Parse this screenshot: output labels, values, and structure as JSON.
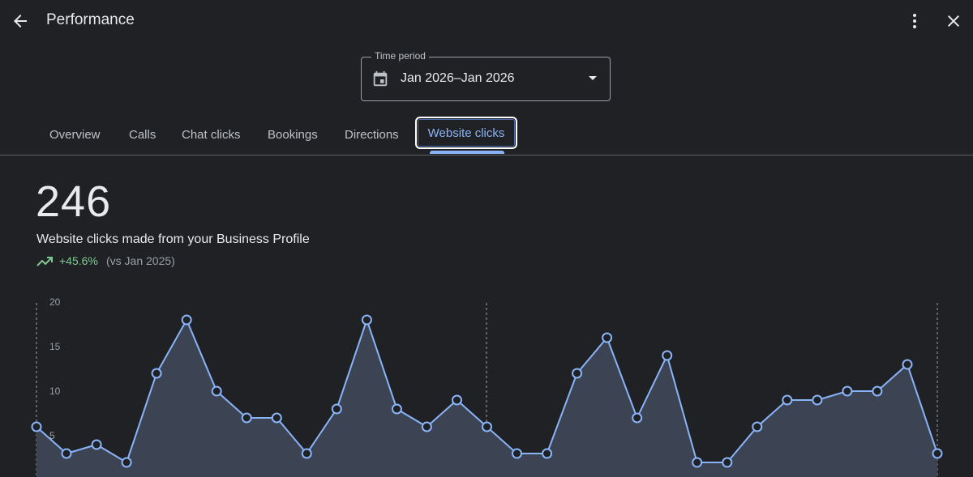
{
  "header": {
    "title": "Performance",
    "back_icon": "arrow-back-icon",
    "more_icon": "more-vert-icon",
    "close_icon": "close-icon"
  },
  "time_period": {
    "label": "Time period",
    "value": "Jan 2026–Jan 2026",
    "icon": "calendar-icon"
  },
  "tabs": [
    {
      "label": "Overview"
    },
    {
      "label": "Calls"
    },
    {
      "label": "Chat clicks"
    },
    {
      "label": "Bookings"
    },
    {
      "label": "Directions"
    },
    {
      "label": "Website clicks",
      "active": true
    }
  ],
  "metric": {
    "value": "246",
    "description": "Website clicks made from your Business Profile",
    "change": "+45.6%",
    "comparison": "(vs Jan 2025)"
  },
  "colors": {
    "accent": "#8ab4f8",
    "positive": "#81c995",
    "background": "#202124"
  },
  "chart_data": {
    "type": "area",
    "y_ticks": [
      "5",
      "10",
      "15",
      "20"
    ],
    "ylim": [
      0,
      20
    ],
    "values": [
      6,
      3,
      4,
      2,
      12,
      18,
      10,
      7,
      7,
      3,
      8,
      18,
      8,
      6,
      9,
      6,
      3,
      3,
      12,
      16,
      7,
      14,
      2,
      2,
      6,
      9,
      9,
      10,
      10,
      13,
      3
    ],
    "grid": false
  }
}
